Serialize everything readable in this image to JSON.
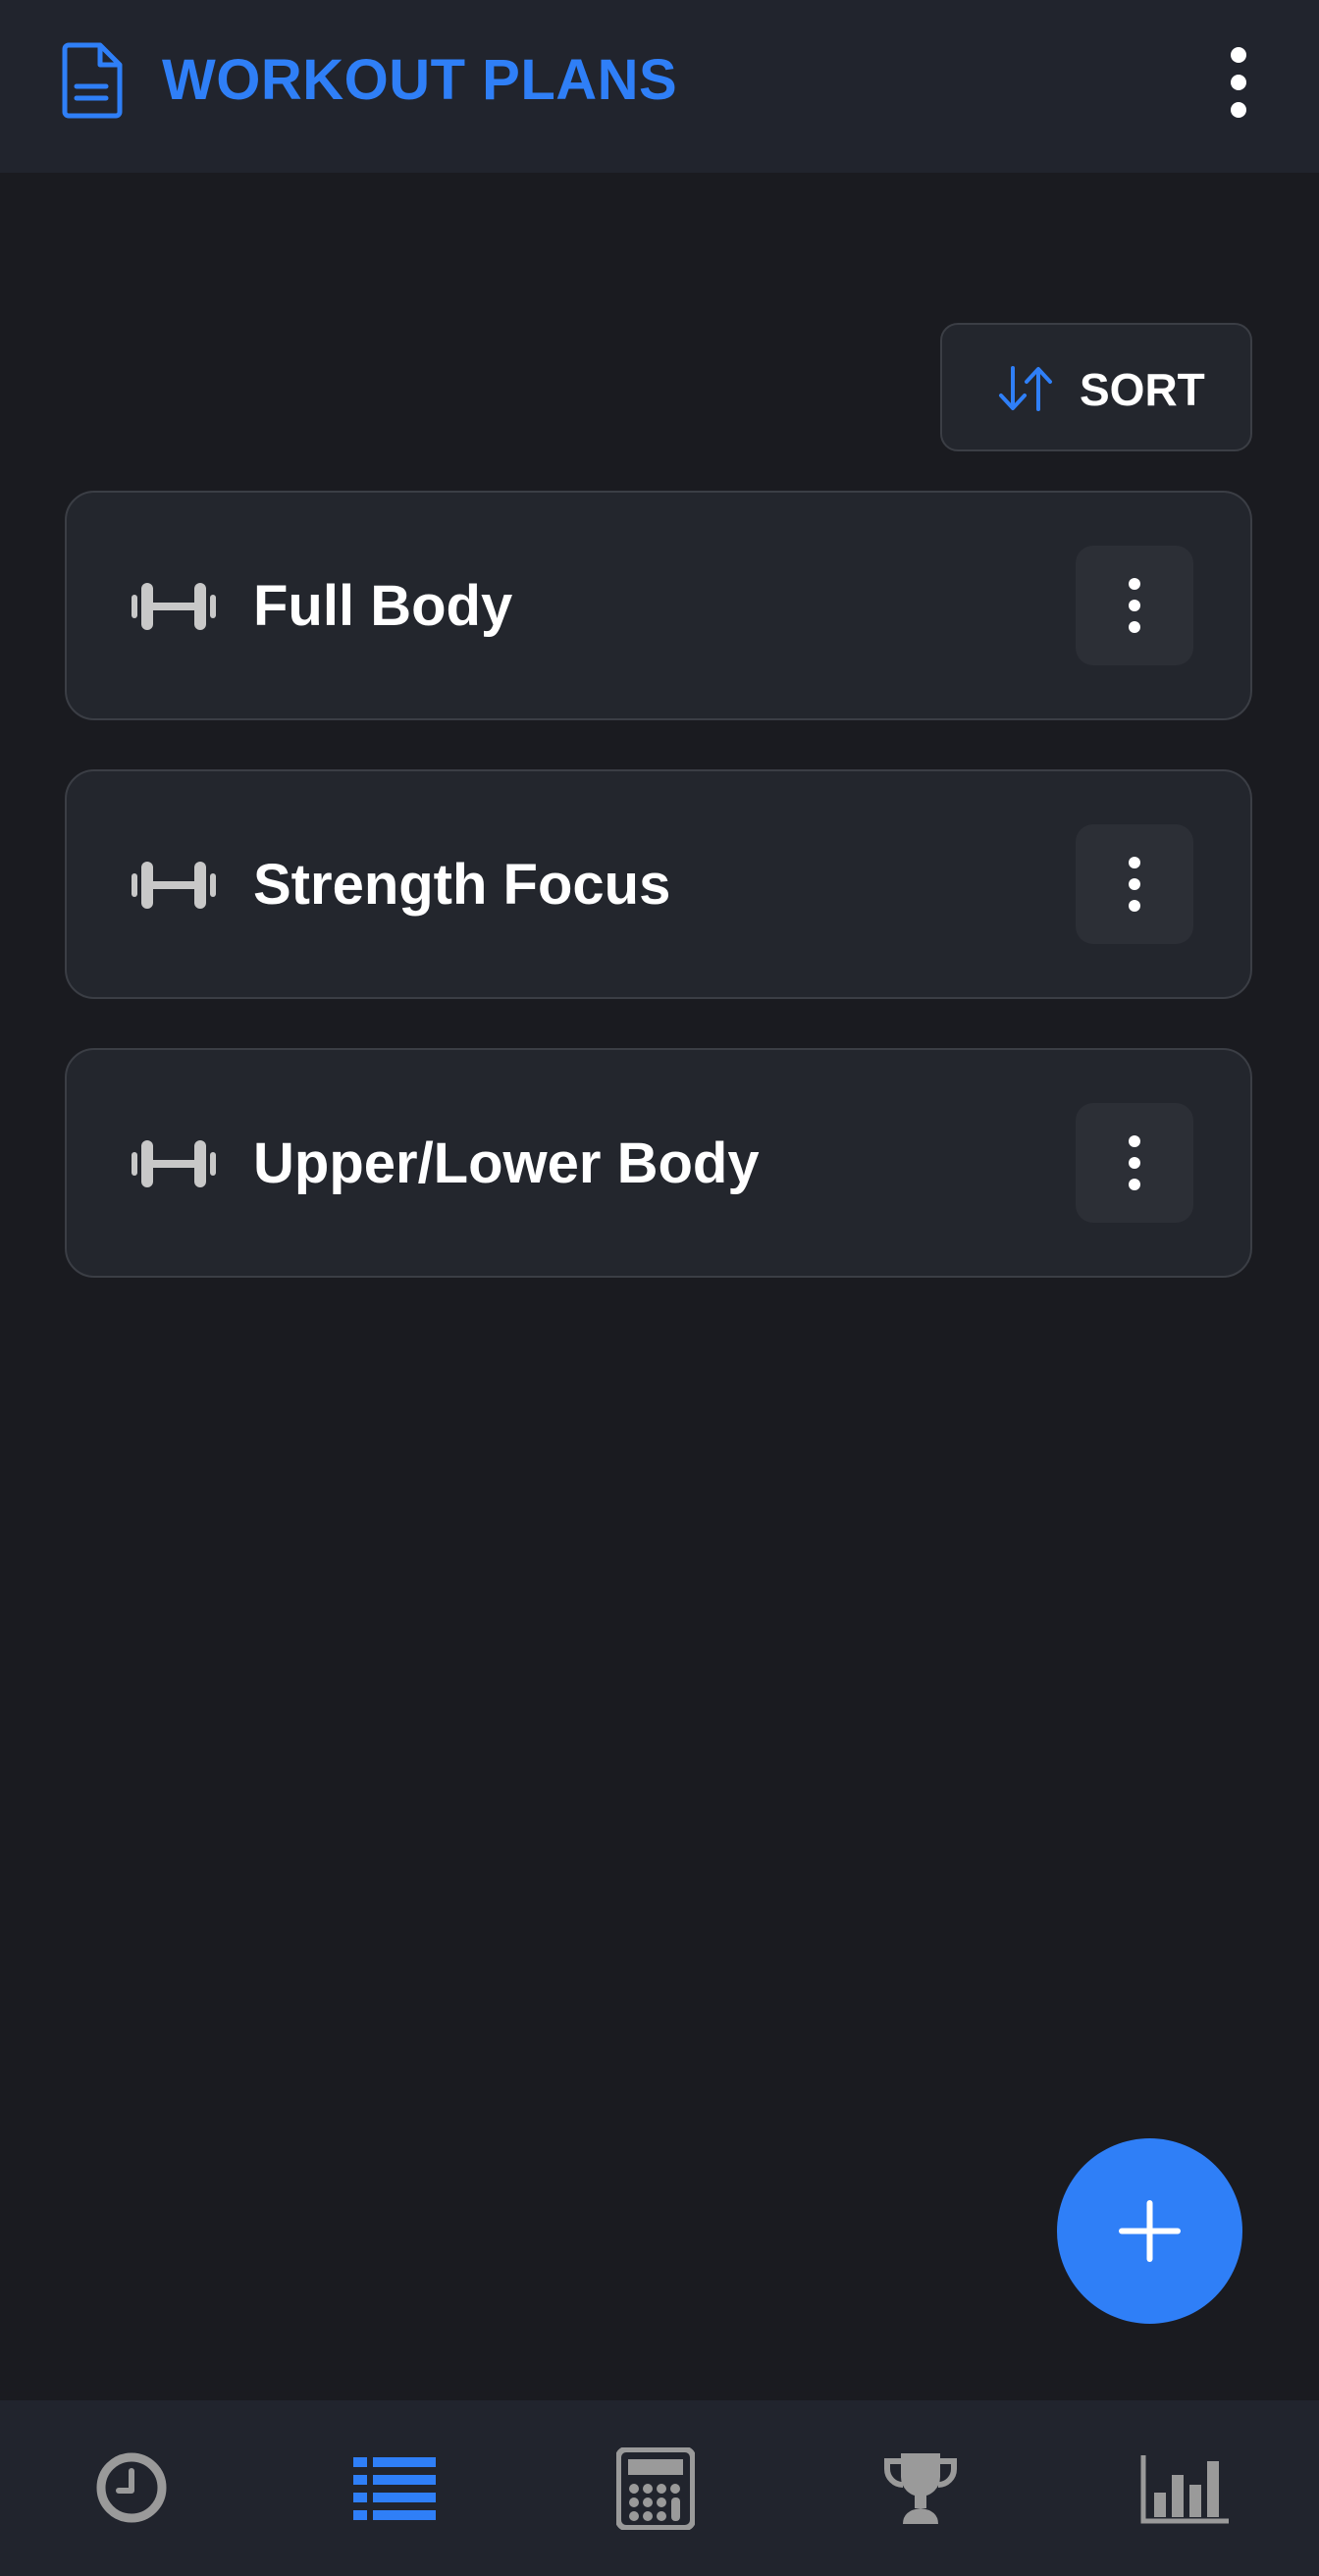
{
  "header": {
    "title": "WORKOUT PLANS",
    "title_icon": "document-icon",
    "menu_icon": "more-vertical-icon"
  },
  "sort": {
    "label": "SORT",
    "icon": "sort-arrows-icon"
  },
  "plans": [
    {
      "name": "Full Body",
      "icon": "dumbbell-icon",
      "menu_icon": "more-vertical-icon"
    },
    {
      "name": "Strength Focus",
      "icon": "dumbbell-icon",
      "menu_icon": "more-vertical-icon"
    },
    {
      "name": "Upper/Lower Body",
      "icon": "dumbbell-icon",
      "menu_icon": "more-vertical-icon"
    }
  ],
  "fab": {
    "icon": "plus-icon"
  },
  "bottom_nav": {
    "items": [
      {
        "icon": "history-clock-icon",
        "active": false
      },
      {
        "icon": "list-icon",
        "active": true
      },
      {
        "icon": "calculator-icon",
        "active": false
      },
      {
        "icon": "trophy-icon",
        "active": false
      },
      {
        "icon": "bar-chart-icon",
        "active": false
      }
    ]
  },
  "colors": {
    "background": "#1a1b20",
    "surface": "#23262d",
    "bar": "#21242d",
    "accent": "#2f7ff7",
    "icon_inactive": "#9a9a9a",
    "icon_light": "#c8c8c8"
  }
}
